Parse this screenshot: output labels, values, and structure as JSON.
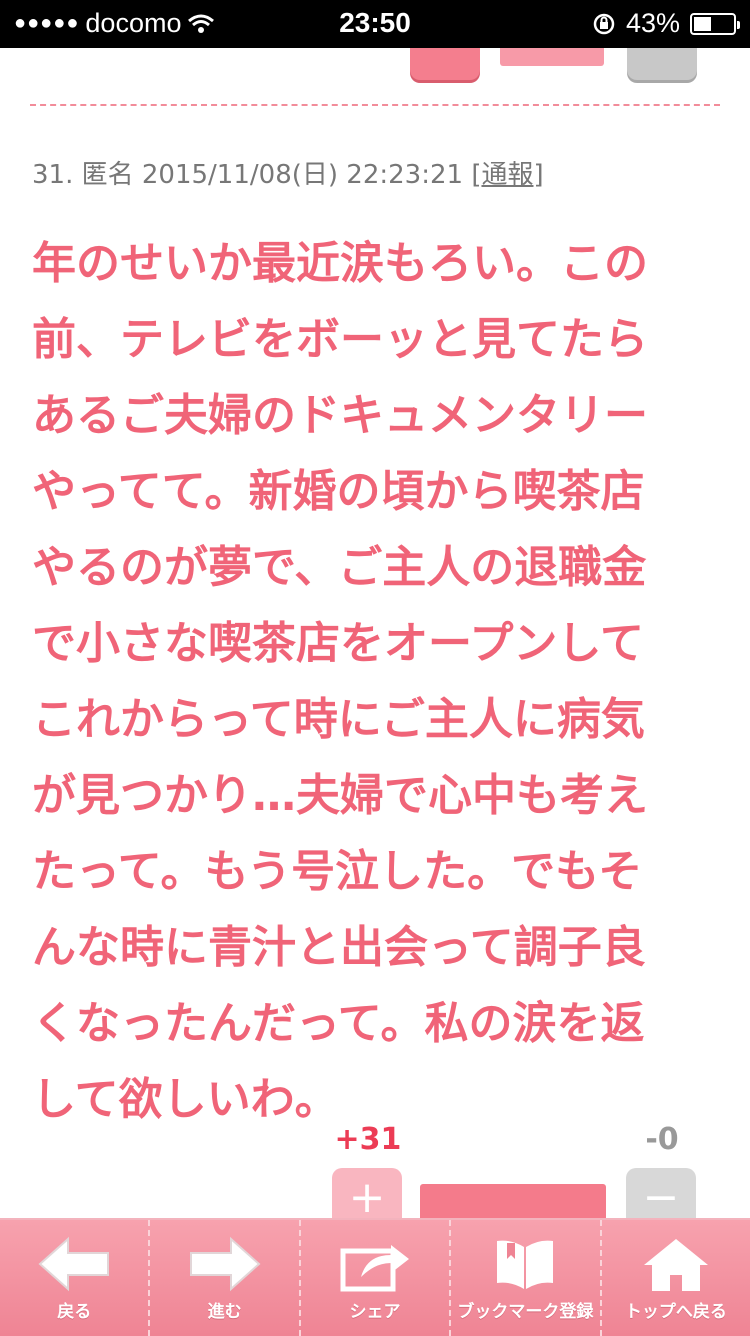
{
  "status": {
    "carrier": "docomo",
    "time": "23:50",
    "battery": "43%",
    "battery_level": 0.43
  },
  "post": {
    "meta_prefix": "31. 匿名 2015/11/08(日) 22:23:21 [",
    "report_label": "通報",
    "meta_suffix": "]",
    "lines": [
      "年のせいか最近涙もろい。この",
      "前、テレビをボーッと見てたら",
      "あるご夫婦のドキュメンタリー",
      "やってて。新婚の頃から喫茶店",
      "やるのが夢で、ご主人の退職金",
      "で小さな喫茶店をオープンして",
      "これからって時にご主人に病気",
      "が見つかり…夫婦で心中も考え",
      "たって。もう号泣した。でもそ",
      "んな時に青汁と出会って調子良",
      "くなったんだって。私の涙を返",
      "して欲しいわ。"
    ]
  },
  "votes": {
    "plus": "+31",
    "minus": "-0",
    "plus_symbol": "+",
    "minus_symbol": "−"
  },
  "toolbar": {
    "back": "戻る",
    "forward": "進む",
    "share": "シェア",
    "bookmark": "ブックマーク登録",
    "top": "トップへ戻る"
  }
}
